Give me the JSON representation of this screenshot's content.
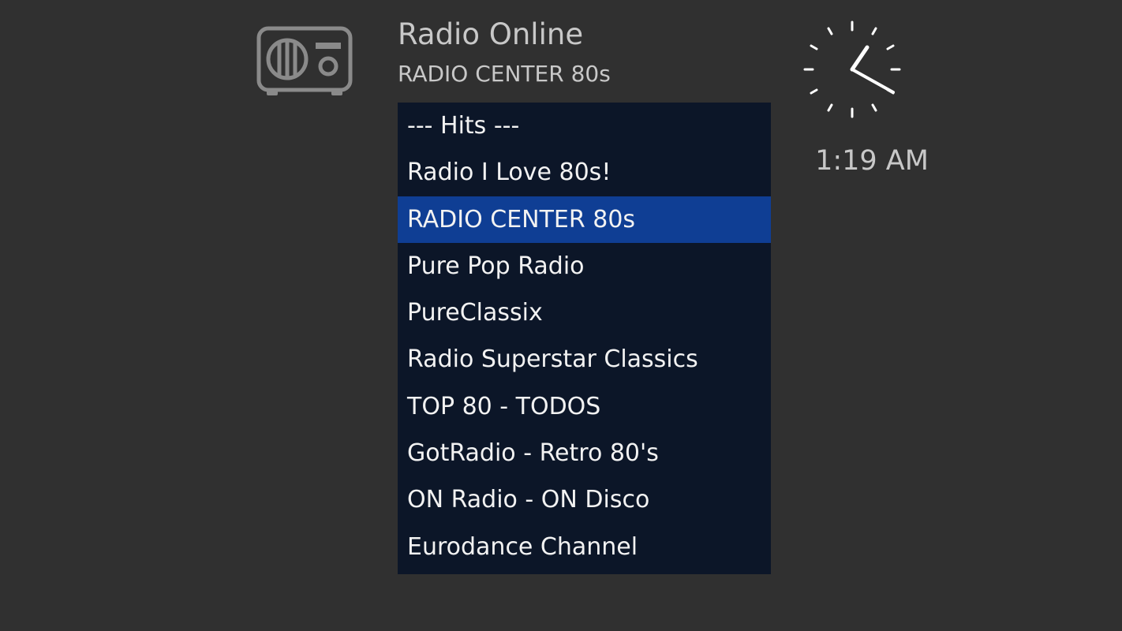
{
  "header": {
    "app_title": "Radio Online",
    "current_station": "RADIO CENTER 80s",
    "logo_icon": "radio-icon"
  },
  "station_list": {
    "selected_index": 2,
    "items": [
      {
        "label": "--- Hits ---"
      },
      {
        "label": "Radio I Love 80s!"
      },
      {
        "label": "RADIO CENTER 80s"
      },
      {
        "label": "Pure Pop Radio"
      },
      {
        "label": "PureClassix"
      },
      {
        "label": "Radio Superstar Classics"
      },
      {
        "label": "TOP 80 - TODOS"
      },
      {
        "label": "GotRadio - Retro 80's"
      },
      {
        "label": "ON Radio - ON Disco"
      },
      {
        "label": "Eurodance Channel"
      }
    ]
  },
  "clock": {
    "time_text": "1:19 AM",
    "icon": "analog-clock-icon"
  },
  "colors": {
    "background": "#303030",
    "list_background": "#0c1628",
    "selected_background": "#0f3e94",
    "text_primary": "#f2f2f2",
    "text_secondary": "#c8c8c8"
  }
}
